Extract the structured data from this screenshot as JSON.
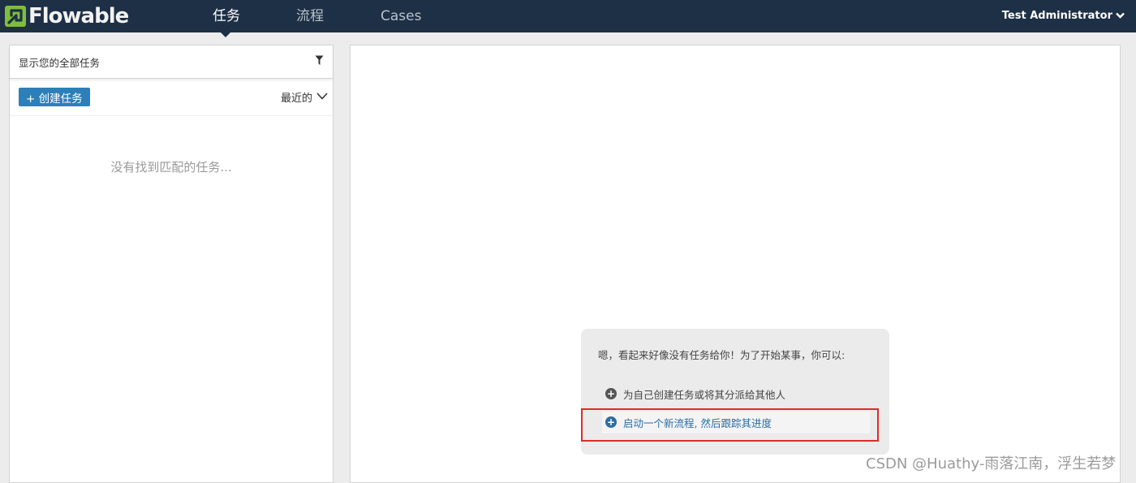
{
  "brand": {
    "name": "Flowable"
  },
  "nav": {
    "tabs": [
      {
        "label": "任务",
        "active": true
      },
      {
        "label": "流程",
        "active": false
      },
      {
        "label": "Cases",
        "active": false
      }
    ],
    "user": "Test Administrator"
  },
  "task_list": {
    "filter_label": "显示您的全部任务",
    "create_button": "+ 创建任务",
    "sort_label": "最近的",
    "empty_message": "没有找到匹配的任务..."
  },
  "help": {
    "intro": "嗯，看起来好像没有任务给你！为了开始某事，你可以:",
    "options": [
      {
        "label": "为自己创建任务或将其分派给其他人"
      },
      {
        "label": "启动一个新流程, 然后跟踪其进度"
      }
    ]
  },
  "watermark": "CSDN @Huathy-雨落江南，浮生若梦",
  "colors": {
    "navbar": "#1e3046",
    "brand_green": "#7fbe3c",
    "primary_button": "#2c7fb8",
    "link": "#2c6ea3",
    "highlight": "#e02a2a"
  }
}
